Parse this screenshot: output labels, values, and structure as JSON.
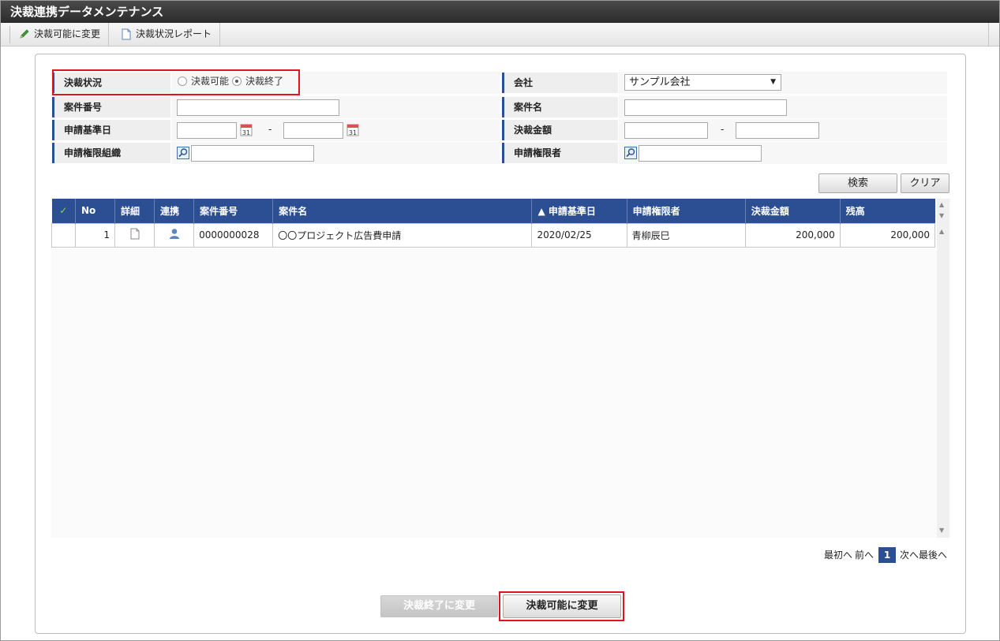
{
  "window": {
    "title": "決裁連携データメンテナンス"
  },
  "toolbar": {
    "items": [
      {
        "label": "決裁可能に変更",
        "icon": "pencil-icon"
      },
      {
        "label": "決裁状況レポート",
        "icon": "document-icon"
      }
    ]
  },
  "search": {
    "status_label": "決裁状況",
    "status_options": [
      "決裁可能",
      "決裁終了"
    ],
    "status_selected": "決裁終了",
    "company_label": "会社",
    "company_value": "サンプル会社",
    "case_number_label": "案件番号",
    "case_name_label": "案件名",
    "apply_date_label": "申請基準日",
    "amount_label": "決裁金額",
    "range_separator": "-",
    "org_label": "申請権限組織",
    "person_label": "申請権限者",
    "search_button": "検索",
    "clear_button": "クリア"
  },
  "grid": {
    "check_header": "✓",
    "columns": [
      "No",
      "詳細",
      "連携",
      "案件番号",
      "案件名",
      "▲ 申請基準日",
      "申請権限者",
      "決裁金額",
      "残高"
    ],
    "rows": [
      {
        "no": "1",
        "case_number": "0000000028",
        "case_name": "〇〇プロジェクト広告費申請",
        "apply_date": "2020/02/25",
        "applicant": "青柳辰巳",
        "amount": "200,000",
        "balance": "200,000"
      }
    ]
  },
  "pager": {
    "first": "最初へ",
    "prev": "前へ",
    "current": "1",
    "next": "次へ",
    "last": "最後へ"
  },
  "footer": {
    "end_button": "決裁終了に変更",
    "enable_button": "決裁可能に変更"
  },
  "colors": {
    "header_blue": "#2c4f93",
    "highlight_red": "#e0141e",
    "titlebar": "#2b2b2b"
  }
}
